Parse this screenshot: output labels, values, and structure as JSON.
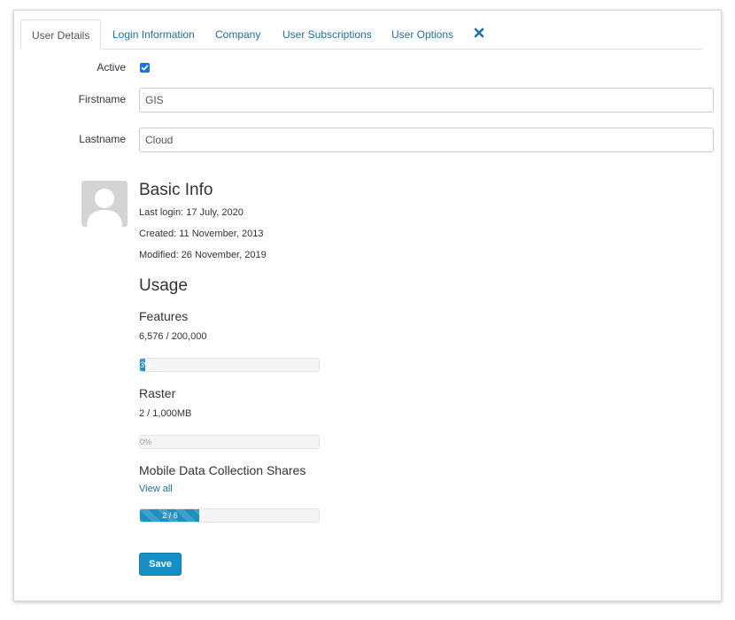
{
  "tabs": [
    {
      "label": "User Details",
      "active": true
    },
    {
      "label": "Login Information",
      "active": false
    },
    {
      "label": "Company",
      "active": false
    },
    {
      "label": "User Subscriptions",
      "active": false
    },
    {
      "label": "User Options",
      "active": false
    }
  ],
  "form": {
    "active_label": "Active",
    "active_checked": true,
    "firstname_label": "Firstname",
    "firstname_value": "GIS",
    "lastname_label": "Lastname",
    "lastname_value": "Cloud"
  },
  "basic_info": {
    "title": "Basic Info",
    "last_login": "Last login: 17 July, 2020",
    "created": "Created: 11 November, 2013",
    "modified": "Modified: 26 November, 2019"
  },
  "usage": {
    "title": "Usage",
    "features": {
      "label": "Features",
      "count": "6,576 / 200,000",
      "progress_text": "3%",
      "progress_fraction": 0.03
    },
    "raster": {
      "label": "Raster",
      "count": "2 / 1,000MB",
      "progress_text": "0%",
      "progress_fraction": 0.0
    },
    "shares": {
      "label": "Mobile Data Collection Shares",
      "link": "View all",
      "progress_text": "2 / 6",
      "progress_fraction": 0.3333
    }
  },
  "save_label": "Save",
  "colors": {
    "accent": "#1590c6",
    "link": "#1f6fa3",
    "checkbox": "#1a73e8"
  },
  "icons": {
    "close_tab": "times-icon",
    "avatar": "user-placeholder-icon",
    "checkmark": "check-icon"
  }
}
